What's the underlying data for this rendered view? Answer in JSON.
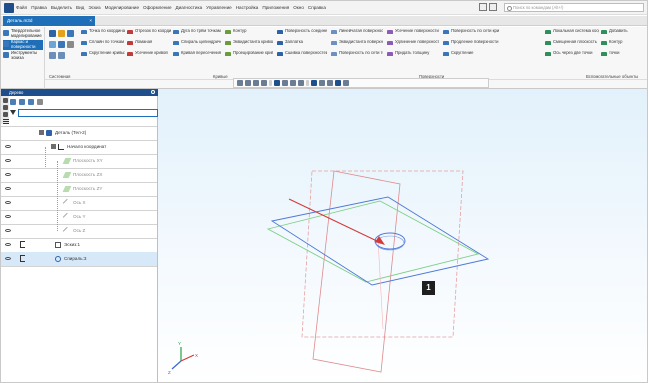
{
  "titlebar": {
    "menu": [
      "Файл",
      "Правка",
      "Выделить",
      "Вид",
      "Эскиз",
      "Моделирование",
      "Оформление",
      "Диагностика",
      "Управление",
      "Настройка",
      "Приложения",
      "Окно",
      "Справка"
    ],
    "search_placeholder": "Поиск по командам (Alt+/)"
  },
  "tab": {
    "title": "Деталь.m3d",
    "close": "×"
  },
  "ribbon": {
    "left_buttons": [
      "Твердотельное моделирование",
      "Каркас и поверхности",
      "Инструменты эскиза"
    ],
    "groups": [
      [
        "Точка по координатам",
        "Сплайн по точкам",
        "Скругление кривых"
      ],
      [
        "Отрезок по координатам",
        "Ломаная",
        "Усечение кривой"
      ],
      [
        "Дуга по трём точкам",
        "Спираль цилиндрическая",
        "Кривая пересечения"
      ],
      [
        "Контур",
        "Эквидистанта кривой",
        "Проецирование кривой"
      ],
      [
        "Поверхность соединения",
        "Заплатка",
        "Сшивка поверхностей"
      ],
      [
        "Линейчатая поверхность",
        "Эквидистанта поверхности",
        "Поверхность по сети точек"
      ],
      [
        "Усечение поверхности",
        "Удлинение поверхности",
        "Придать толщину"
      ],
      [
        "Поверхность по сети кривых",
        "Продление поверхности",
        "Скругление"
      ],
      [
        "Локальная система коорд.",
        "Смещенная плоскость",
        "Ось через две точки"
      ],
      [
        "Добавить",
        "Контур",
        "точки"
      ]
    ],
    "section_labels": [
      "Системная",
      "Кривые",
      "Поверхности",
      "Вспомогательные объекты"
    ]
  },
  "panel": {
    "title": "Дерево",
    "search_placeholder": "",
    "tree": [
      {
        "label": "Деталь (Тел-2)"
      },
      {
        "label": "Начало координат"
      },
      {
        "label": "Плоскость XY"
      },
      {
        "label": "Плоскость ZX"
      },
      {
        "label": "Плоскость ZY"
      },
      {
        "label": "Ось X"
      },
      {
        "label": "Ось Y"
      },
      {
        "label": "Ось Z"
      },
      {
        "label": "Эскиз:1"
      },
      {
        "label": "Спираль:3"
      }
    ]
  },
  "viewport": {
    "callout_number": "1",
    "axis_labels": [
      "X",
      "Y",
      "Z"
    ]
  },
  "colors": {
    "accent": "#1f6fb8",
    "panel_header": "#1f4e8c",
    "plane_blue": "#4f79d6",
    "plane_green": "#7fcf86",
    "plane_red": "#e08a8a",
    "arrow": "#d33b3b"
  }
}
